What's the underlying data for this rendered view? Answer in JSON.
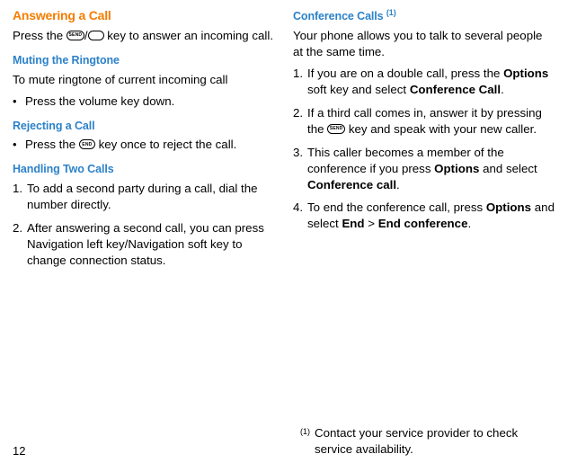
{
  "left": {
    "h1": "Answering a Call",
    "p1_a": "Press the ",
    "p1_b": "/",
    "p1_c": " key to answer an incoming call.",
    "h2": "Muting the Ringtone",
    "p2": "To mute ringtone of current incoming call",
    "b1": "Press the volume key down.",
    "h3": "Rejecting a Call",
    "b2_a": "Press the ",
    "b2_b": " key once to reject the call.",
    "h4": "Handling Two Calls",
    "n1": "To add a second party during a call, dial the number directly.",
    "n2": "After answering a second call, you can press Navigation left key/Navigation soft key to change connection status."
  },
  "right": {
    "h1_a": "Conference Calls ",
    "h1_sup": "(1)",
    "p1": "Your phone allows you to talk to several people at the same time.",
    "n1_a": "If you are on a double call, press the ",
    "n1_b": "Options",
    "n1_c": " soft key and select ",
    "n1_d": "Conference Call",
    "n1_e": ".",
    "n2_a": "If a third call comes in, answer it by pressing the ",
    "n2_b": " key and speak with your new caller.",
    "n3_a": "This caller becomes a member of the conference if you press ",
    "n3_b": "Options",
    "n3_c": " and select ",
    "n3_d": "Conference call",
    "n3_e": ".",
    "n4_a": "To end the conference call, press ",
    "n4_b": "Options",
    "n4_c": " and select ",
    "n4_d": "End",
    "n4_e": " > ",
    "n4_f": "End conference",
    "n4_g": "."
  },
  "footnote": {
    "marker": "(1)",
    "text": "Contact your service provider to check service availability."
  },
  "icons": {
    "send": "SEND",
    "end": "END"
  },
  "pageNumber": "12"
}
